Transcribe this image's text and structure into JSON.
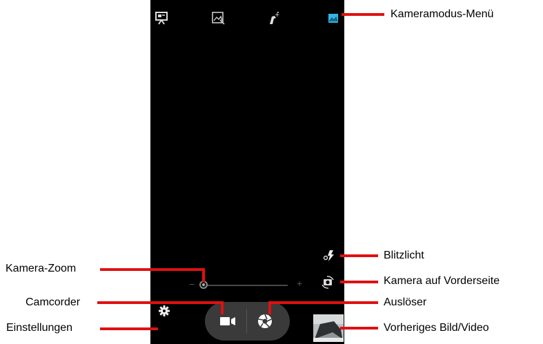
{
  "camera_ui": {
    "mode_icons": [
      "presentation-mode-icon",
      "panorama-mode-icon",
      "effects-mode-icon",
      "scene-mode-icon"
    ],
    "zoom_minus": "−",
    "zoom_plus": "+",
    "zoom_level": 0,
    "accent_color": "#33b5e5"
  },
  "annotations": {
    "camera_mode_menu": "Kameramodus-Menü",
    "flash": "Blitzlicht",
    "camera_zoom": "Kamera-Zoom",
    "front_camera": "Kamera auf Vorderseite",
    "camcorder": "Camcorder",
    "shutter": "Auslöser",
    "settings": "Einstellungen",
    "previous_media": "Vorheriges Bild/Video"
  }
}
